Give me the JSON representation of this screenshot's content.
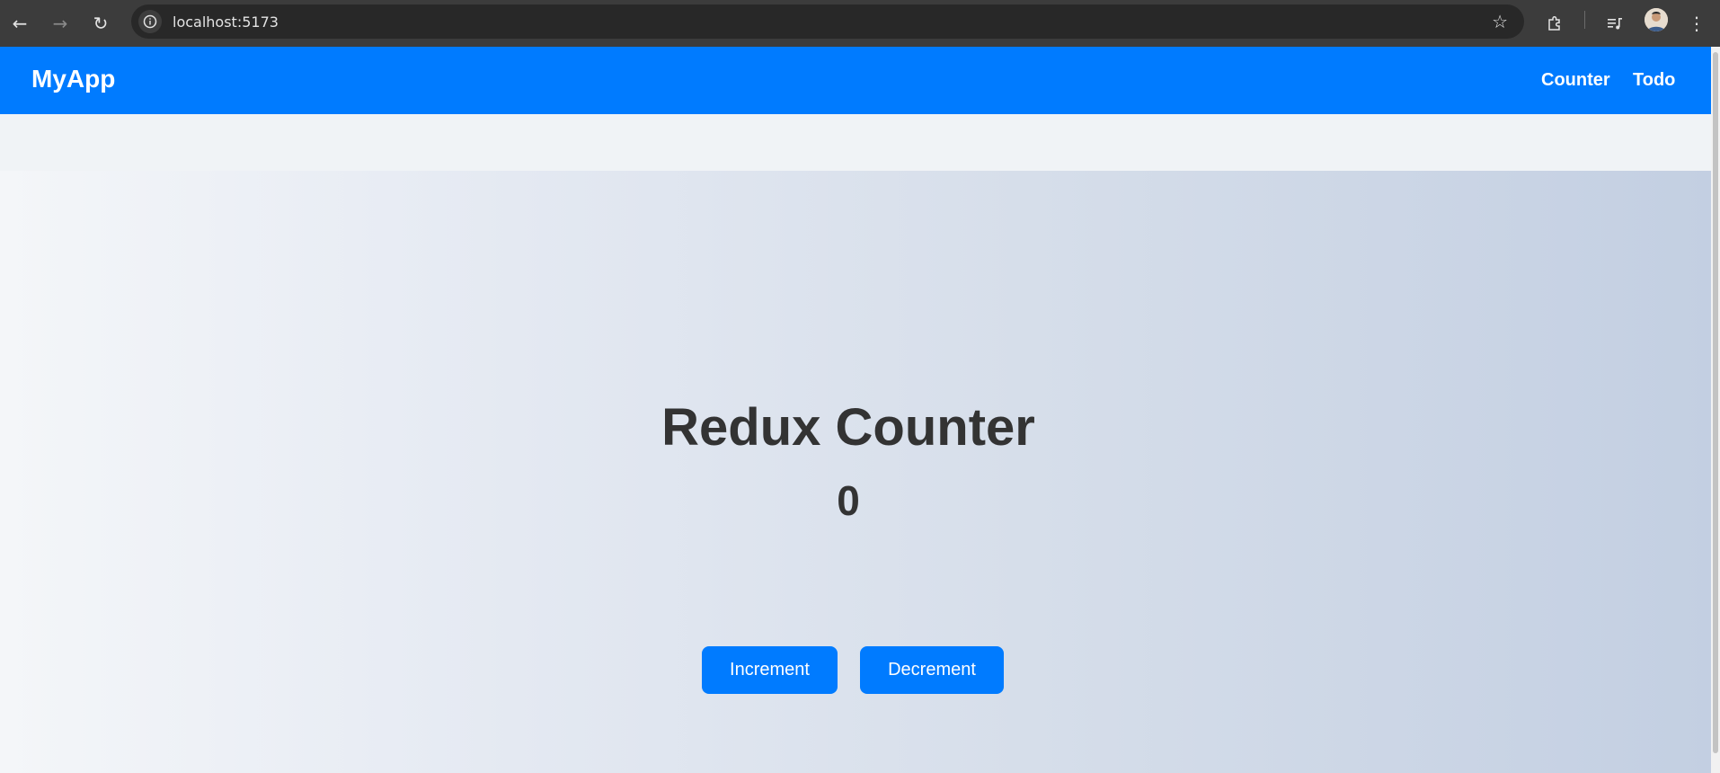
{
  "browser": {
    "url": "localhost:5173",
    "icons": [
      "back-icon",
      "forward-icon",
      "reload-icon",
      "site-info-icon",
      "star-icon",
      "extensions-icon",
      "media-icon",
      "avatar",
      "menu-icon"
    ]
  },
  "navbar": {
    "brand": "MyApp",
    "links": [
      "Counter",
      "Todo"
    ],
    "color": "#007bff"
  },
  "counter": {
    "title": "Redux Counter",
    "value": "0",
    "increment_label": "Increment",
    "decrement_label": "Decrement"
  }
}
